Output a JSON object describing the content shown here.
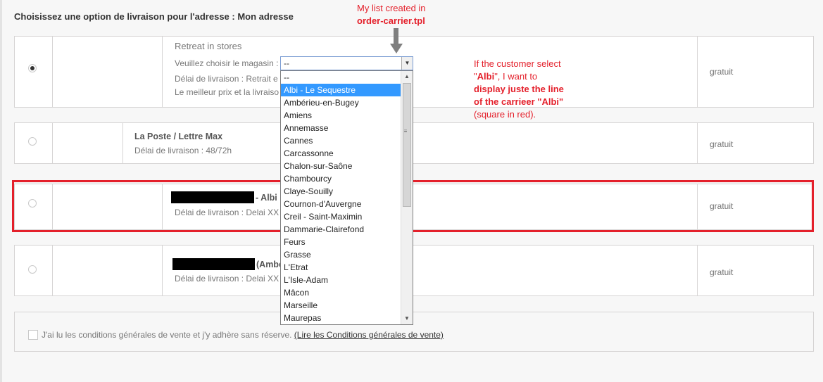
{
  "heading": "Choisissez une option de livraison pour l'adresse : Mon adresse",
  "carriers": [
    {
      "title": "Retreat in stores",
      "select_label": "Veuillez choisir le magasin :",
      "delay": "Délai de livraison : Retrait e",
      "best_price": "Le meilleur prix et la livraiso",
      "price": "gratuit",
      "selected": true
    },
    {
      "title": "La Poste / Lettre Max",
      "delay": "Délai de livraison : 48/72h",
      "price": "gratuit",
      "selected": false
    },
    {
      "title_suffix": "- Albi",
      "delay": "Délai de livraison : Delai XX",
      "price": "gratuit",
      "selected": false
    },
    {
      "title_suffix": "(Ambe",
      "delay": "Délai de livraison : Delai XX",
      "price": "gratuit",
      "selected": false
    }
  ],
  "select": {
    "value": "--",
    "options": [
      "--",
      "Albi - Le Sequestre",
      "Ambérieu-en-Bugey",
      "Amiens",
      "Annemasse",
      "Cannes",
      "Carcassonne",
      "Chalon-sur-Saône",
      "Chambourcy",
      "Claye-Souilly",
      "Cournon-d'Auvergne",
      "Creil - Saint-Maximin",
      "Dammarie-Clairefond",
      "Feurs",
      "Grasse",
      "L'Etrat",
      "L'Isle-Adam",
      "Mâcon",
      "Marseille",
      "Maurepas"
    ],
    "highlighted_index": 1,
    "arrow_glyph": "▼",
    "scroll_up_glyph": "▲",
    "scroll_down_glyph": "▼",
    "grip_glyph": "≡"
  },
  "annotations": {
    "top_line1": "My list created in",
    "top_line2": "order-carrier.tpl",
    "right_1": "If the customer select",
    "right_2_quote_open": "\"",
    "right_2_bold": "Albi",
    "right_2_rest": "\", I want to",
    "right_3": "display juste the line",
    "right_4_bold": "of the carrieer \"Albi\"",
    "right_5": "(square in red).",
    "color": "#e4202b"
  },
  "terms": {
    "text": "J'ai lu les conditions générales de vente et j'y adhère sans réserve.",
    "link": "(Lire les Conditions générales de vente)",
    "checked": false
  }
}
